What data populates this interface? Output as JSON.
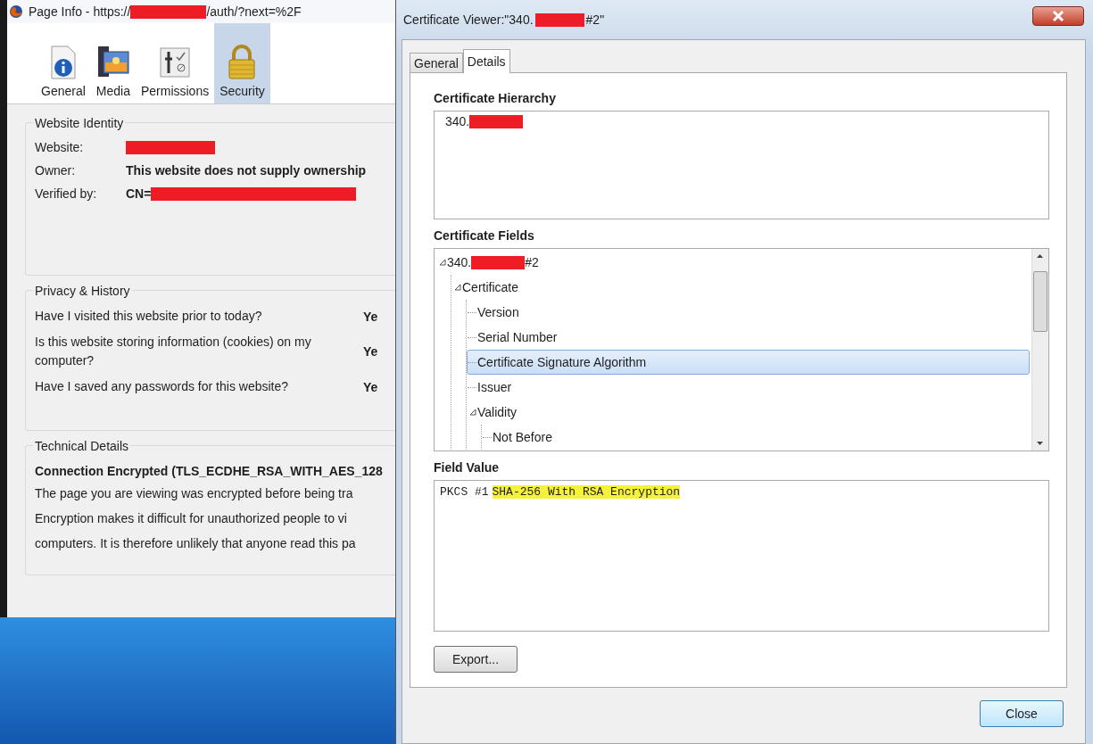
{
  "page_info": {
    "title": [
      {
        "text": "Page Info - https://"
      },
      {
        "kind": "redaction"
      },
      {
        "text": "/auth/?next=%2F"
      }
    ],
    "tabs": [
      {
        "label": "General",
        "kind": "info",
        "selected": false
      },
      {
        "label": "Media",
        "kind": "media",
        "selected": false
      },
      {
        "label": "Permissions",
        "kind": "permissions",
        "selected": false
      },
      {
        "label": "Security",
        "kind": "lock",
        "selected": true
      }
    ],
    "identity": {
      "heading": "Website Identity",
      "rows": [
        {
          "label": "Website:",
          "value": [
            {
              "kind": "redaction"
            }
          ]
        },
        {
          "label": "Owner:",
          "value": [
            {
              "text": "This website does not supply ownership"
            }
          ]
        },
        {
          "label": "Verified by:",
          "value": [
            {
              "text": "CN="
            },
            {
              "kind": "redaction"
            }
          ]
        }
      ]
    },
    "privacy": {
      "heading": "Privacy & History",
      "rows": [
        {
          "question": "Have I visited this website prior to today?",
          "answer": "Ye"
        },
        {
          "question": "Is this website storing information (cookies) on my computer?",
          "answer": "Ye"
        },
        {
          "question": "Have I saved any passwords for this website?",
          "answer": "Ye"
        }
      ]
    },
    "technical": {
      "heading": "Technical Details",
      "headline": "Connection Encrypted (TLS_ECDHE_RSA_WITH_AES_128",
      "lines": [
        "The page you are viewing was encrypted before being tra",
        "Encryption makes it difficult for unauthorized people to vi",
        "computers. It is therefore unlikely that anyone read this pa"
      ]
    }
  },
  "cert_viewer": {
    "title": [
      {
        "text": "Certificate Viewer:\"340."
      },
      {
        "kind": "redaction"
      },
      {
        "text": " #2\""
      }
    ],
    "tabs": [
      {
        "label": "General",
        "selected": false
      },
      {
        "label": "Details",
        "selected": true
      }
    ],
    "hierarchy": {
      "heading": "Certificate Hierarchy",
      "items": [
        {
          "parts": [
            {
              "text": "340."
            },
            {
              "kind": "redaction"
            }
          ]
        }
      ]
    },
    "fields": {
      "heading": "Certificate Fields",
      "tree": [
        {
          "parts": [
            {
              "text": "340."
            },
            {
              "kind": "redaction"
            },
            {
              "text": "#2"
            }
          ],
          "expanded": true,
          "selected": false,
          "children": [
            {
              "label": "Certificate",
              "expanded": true,
              "selected": false,
              "children": [
                {
                  "label": "Version",
                  "selected": false
                },
                {
                  "label": "Serial Number",
                  "selected": false
                },
                {
                  "label": "Certificate Signature Algorithm",
                  "selected": true
                },
                {
                  "label": "Issuer",
                  "selected": false
                },
                {
                  "label": "Validity",
                  "expanded": true,
                  "selected": false,
                  "children": [
                    {
                      "label": "Not Before",
                      "selected": false
                    }
                  ]
                }
              ]
            }
          ]
        }
      ]
    },
    "field_value": {
      "heading": "Field Value",
      "text": "PKCS #1",
      "highlight": "SHA-256 With RSA Encryption"
    },
    "buttons": {
      "export": "Export...",
      "close": "Close"
    }
  }
}
